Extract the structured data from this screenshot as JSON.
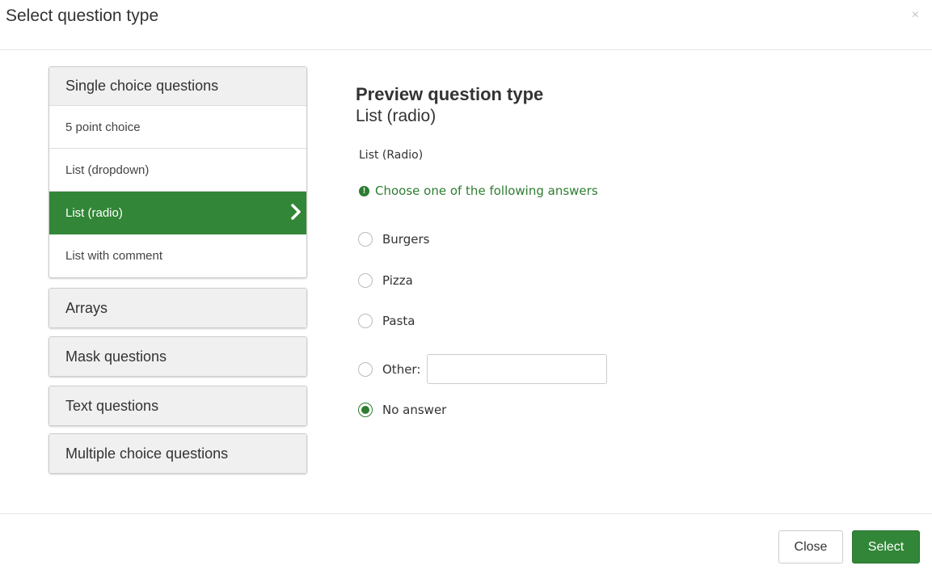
{
  "modal": {
    "title": "Select question type",
    "close_symbol": "×"
  },
  "sidebar": {
    "single_choice": {
      "label": "Single choice questions",
      "items": [
        {
          "label": "5 point choice",
          "active": false
        },
        {
          "label": "List (dropdown)",
          "active": false
        },
        {
          "label": "List (radio)",
          "active": true
        },
        {
          "label": "List with comment",
          "active": false
        }
      ]
    },
    "groups": [
      {
        "label": "Arrays"
      },
      {
        "label": "Mask questions"
      },
      {
        "label": "Text questions"
      },
      {
        "label": "Multiple choice questions"
      }
    ]
  },
  "preview": {
    "heading": "Preview question type",
    "subheading": "List (radio)",
    "question_text": "List (Radio)",
    "tip_icon": "!",
    "tip": "Choose one of the following answers",
    "options": [
      {
        "label": "Burgers",
        "checked": false
      },
      {
        "label": "Pizza",
        "checked": false
      },
      {
        "label": "Pasta",
        "checked": false
      },
      {
        "label": "Other:",
        "checked": false,
        "other_value": ""
      },
      {
        "label": "No answer",
        "checked": true
      }
    ]
  },
  "footer": {
    "close_label": "Close",
    "select_label": "Select"
  },
  "colors": {
    "accent": "#328637",
    "tip": "#2e7d32"
  },
  "icons": {
    "close": "close-icon",
    "chevron": "chevron-right-icon",
    "tip": "exclamation-circle-icon"
  }
}
